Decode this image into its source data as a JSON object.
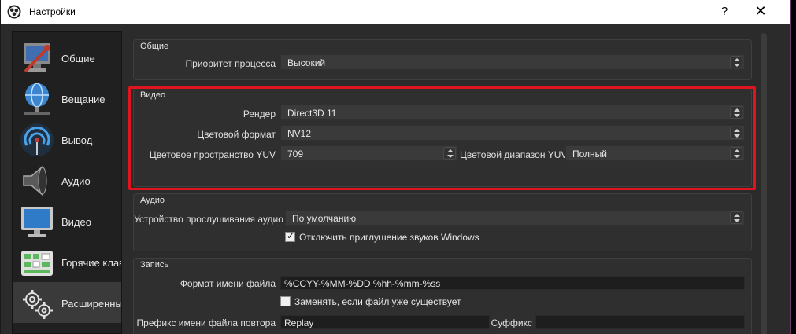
{
  "window": {
    "title": "Настройки",
    "help": "?",
    "close": "✕"
  },
  "sidebar": {
    "items": [
      {
        "label": "Общие",
        "icon": "settings-monitor-icon"
      },
      {
        "label": "Вещание",
        "icon": "globe-network-icon"
      },
      {
        "label": "Вывод",
        "icon": "broadcast-output-icon"
      },
      {
        "label": "Аудио",
        "icon": "speaker-icon"
      },
      {
        "label": "Видео",
        "icon": "monitor-icon"
      },
      {
        "label": "Горячие клавиши",
        "icon": "keyboard-icon"
      },
      {
        "label": "Расширенные",
        "icon": "gears-icon"
      }
    ],
    "active_index": 6
  },
  "general": {
    "title": "Общие",
    "priority_label": "Приоритет процесса",
    "priority_value": "Высокий"
  },
  "video": {
    "title": "Видео",
    "renderer_label": "Рендер",
    "renderer_value": "Direct3D 11",
    "color_format_label": "Цветовой формат",
    "color_format_value": "NV12",
    "color_space_label": "Цветовое пространство YUV",
    "color_space_value": "709",
    "color_range_label": "Цветовой диапазон YUV",
    "color_range_value": "Полный"
  },
  "audio": {
    "title": "Аудио",
    "monitoring_label": "Устройство прослушивания аудио",
    "monitoring_value": "По умолчанию",
    "ducking_label": "Отключить приглушение звуков Windows",
    "ducking_checked": true
  },
  "recording": {
    "title": "Запись",
    "filename_format_label": "Формат имени файла",
    "filename_format_value": "%CCYY-%MM-%DD %hh-%mm-%ss",
    "overwrite_label": "Заменять, если файл уже существует",
    "overwrite_checked": false,
    "replay_prefix_label": "Префикс имени файла повтора",
    "replay_prefix_value": "Replay",
    "suffix_label": "Суффикс",
    "suffix_value": ""
  },
  "colors": {
    "highlight": "#e0141e",
    "background": "#2b2b2b",
    "panel": "#2f2f2f"
  }
}
